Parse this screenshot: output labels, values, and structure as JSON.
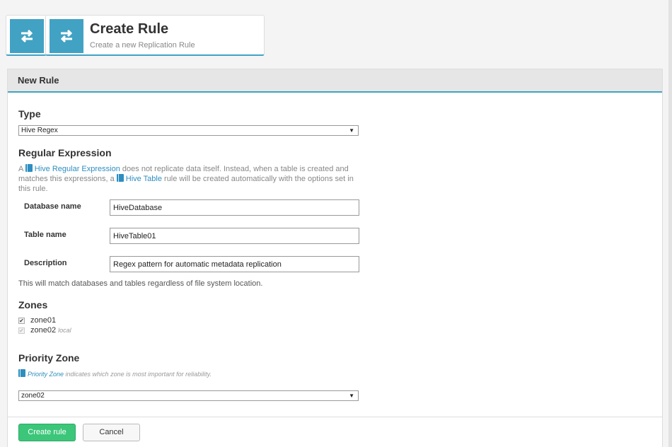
{
  "header": {
    "title": "Create Rule",
    "subtitle": "Create a new Replication Rule",
    "icon": "swap-arrows-icon",
    "accent": "#41a2c4"
  },
  "panel": {
    "title": "New Rule"
  },
  "type_section": {
    "heading": "Type",
    "selected": "Hive Regex"
  },
  "regex_section": {
    "heading": "Regular Expression",
    "help_prefix": "A ",
    "help_link1": "Hive Regular Expression",
    "help_mid": " does not replicate data itself. Instead, when a table is created and matches this expressions, a ",
    "help_link2": "Hive Table",
    "help_suffix": " rule will be created automatically with the options set in this rule.",
    "fields": [
      {
        "label": "Database name",
        "value": "HiveDatabase"
      },
      {
        "label": "Table name",
        "value": "HiveTable01"
      },
      {
        "label": "Description",
        "value": "Regex pattern for automatic metadata replication"
      }
    ],
    "note": "This will match databases and tables regardless of file system location."
  },
  "zones_section": {
    "heading": "Zones",
    "zones": [
      {
        "name": "zone01",
        "checked": true,
        "tag": ""
      },
      {
        "name": "zone02",
        "checked": true,
        "tag": "local"
      }
    ]
  },
  "priority_section": {
    "heading": "Priority Zone",
    "help_link": "Priority Zone",
    "help_text": " indicates which zone is most important for reliability.",
    "selected": "zone02"
  },
  "actions": {
    "primary": "Create rule",
    "secondary": "Cancel",
    "primary_color": "#3cc67a"
  }
}
